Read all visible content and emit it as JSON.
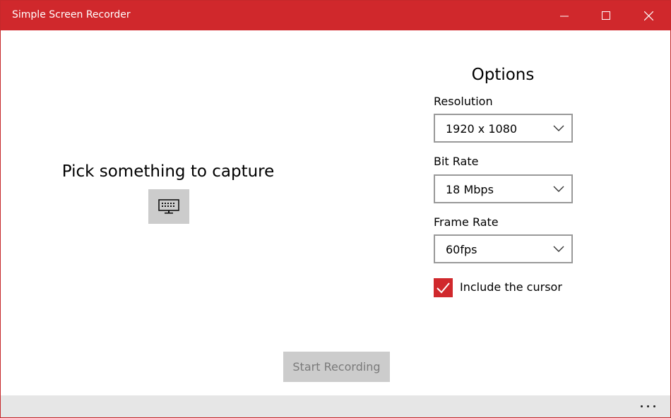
{
  "window": {
    "title": "Simple Screen Recorder",
    "accent_color": "#d0282c"
  },
  "capture": {
    "heading": "Pick something to capture",
    "button_icon": "monitor-icon"
  },
  "options": {
    "heading": "Options",
    "resolution": {
      "label": "Resolution",
      "value": "1920 x 1080"
    },
    "bit_rate": {
      "label": "Bit Rate",
      "value": "18 Mbps"
    },
    "frame_rate": {
      "label": "Frame Rate",
      "value": "60fps"
    },
    "include_cursor": {
      "label": "Include the cursor",
      "checked": true
    }
  },
  "actions": {
    "start_label": "Start Recording"
  }
}
